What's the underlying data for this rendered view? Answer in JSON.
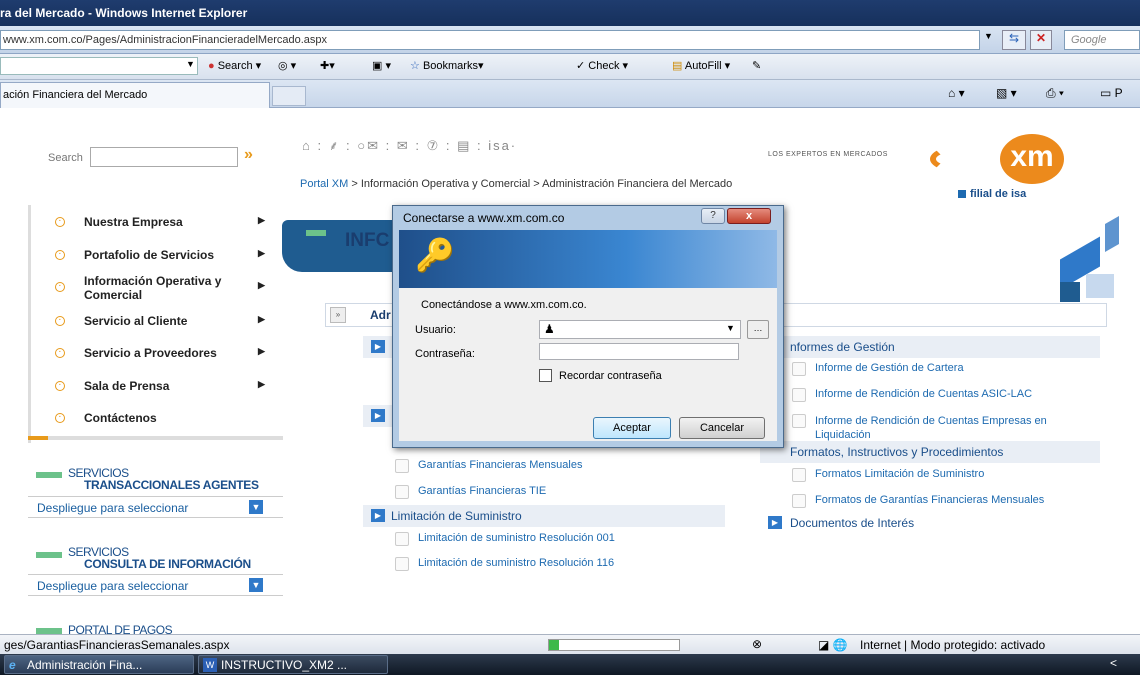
{
  "window": {
    "title": "ra del Mercado - Windows Internet Explorer",
    "address": "www.xm.com.co/Pages/AdministracionFinancieradelMercado.aspx",
    "search_placeholder": "Google"
  },
  "toolbar": {
    "search_label": "Search",
    "bookmarks_label": "Bookmarks",
    "check_label": "Check",
    "autofill_label": "AutoFill"
  },
  "tab": {
    "label": "ación Financiera del Mercado"
  },
  "site": {
    "search_label": "Search",
    "icons_text": "⌂ : ⸙ : ○✉ : ✉ : ⑦ : ▤ : isa·",
    "breadcrumb_portal": "Portal XM",
    "breadcrumb_sep": " > ",
    "breadcrumb_rest": "Información Operativa y Comercial > Administración Financiera del Mercado",
    "logo_tagline": "LOS EXPERTOS EN MERCADOS",
    "logo_text": "xm",
    "logo_filial": "filial de isa"
  },
  "nav": {
    "items": [
      {
        "label": "Nuestra Empresa",
        "arrow": "▶"
      },
      {
        "label": "Portafolio de Servicios",
        "arrow": "▶"
      },
      {
        "label": "Información Operativa y Comercial",
        "arrow": "▶"
      },
      {
        "label": "Servicio al Cliente",
        "arrow": "▶"
      },
      {
        "label": "Servicio a Proveedores",
        "arrow": "▶"
      },
      {
        "label": "Sala de Prensa",
        "arrow": "▶"
      },
      {
        "label": "Contáctenos",
        "arrow": ""
      }
    ]
  },
  "services": [
    {
      "line1": "SERVICIOS",
      "line2": "TRANSACCIONALES AGENTES",
      "dropdown": "Despliegue para seleccionar"
    },
    {
      "line1": "SERVICIOS",
      "line2": "CONSULTA DE INFORMACIÓN",
      "dropdown": "Despliegue para seleccionar"
    },
    {
      "line1": "PORTAL DE PAGOS"
    }
  ],
  "content": {
    "title": "INFC",
    "adm_label": "Adr",
    "left_docs_top": [
      "Garantías Financieras Mensuales",
      "Garantías Financieras TIE"
    ],
    "limitacion": {
      "title": "Limitación de Suministro",
      "docs": [
        "Limitación de suministro Resolución 001",
        "Limitación de suministro Resolución 116"
      ]
    },
    "informes": {
      "title": "nformes de Gestión",
      "docs": [
        "Informe de Gestión de Cartera",
        "Informe de Rendición de Cuentas ASIC-LAC",
        "Informe de Rendición de Cuentas Empresas en Liquidación"
      ]
    },
    "formatos": {
      "title": "Formatos, Instructivos y Procedimientos",
      "docs": [
        "Formatos Limitación de Suministro",
        "Formatos de Garantías Financieras Mensuales"
      ]
    },
    "documentos": {
      "title": "Documentos de Interés"
    }
  },
  "dialog": {
    "title": "Conectarse a www.xm.com.co",
    "connecting": "Conectándose a www.xm.com.co.",
    "user_label": "Usuario:",
    "password_label": "Contraseña:",
    "remember_label": "Recordar contraseña",
    "ok_label": "Aceptar",
    "cancel_label": "Cancelar",
    "help": "?",
    "close": "x"
  },
  "status": {
    "url": "ges/GarantiasFinancierasSemanales.aspx",
    "zone": "Internet | Modo protegido: activado",
    "progress": 0.08
  },
  "taskbar": {
    "items": [
      "Administración Fina...",
      "INSTRUCTIVO_XM2 ..."
    ],
    "tray": "<"
  },
  "colors": {
    "accent_orange": "#ec8a1c",
    "link_blue": "#1d6ab0",
    "dark_blue": "#1a3d6e",
    "green_bar": "#6cc28a"
  }
}
